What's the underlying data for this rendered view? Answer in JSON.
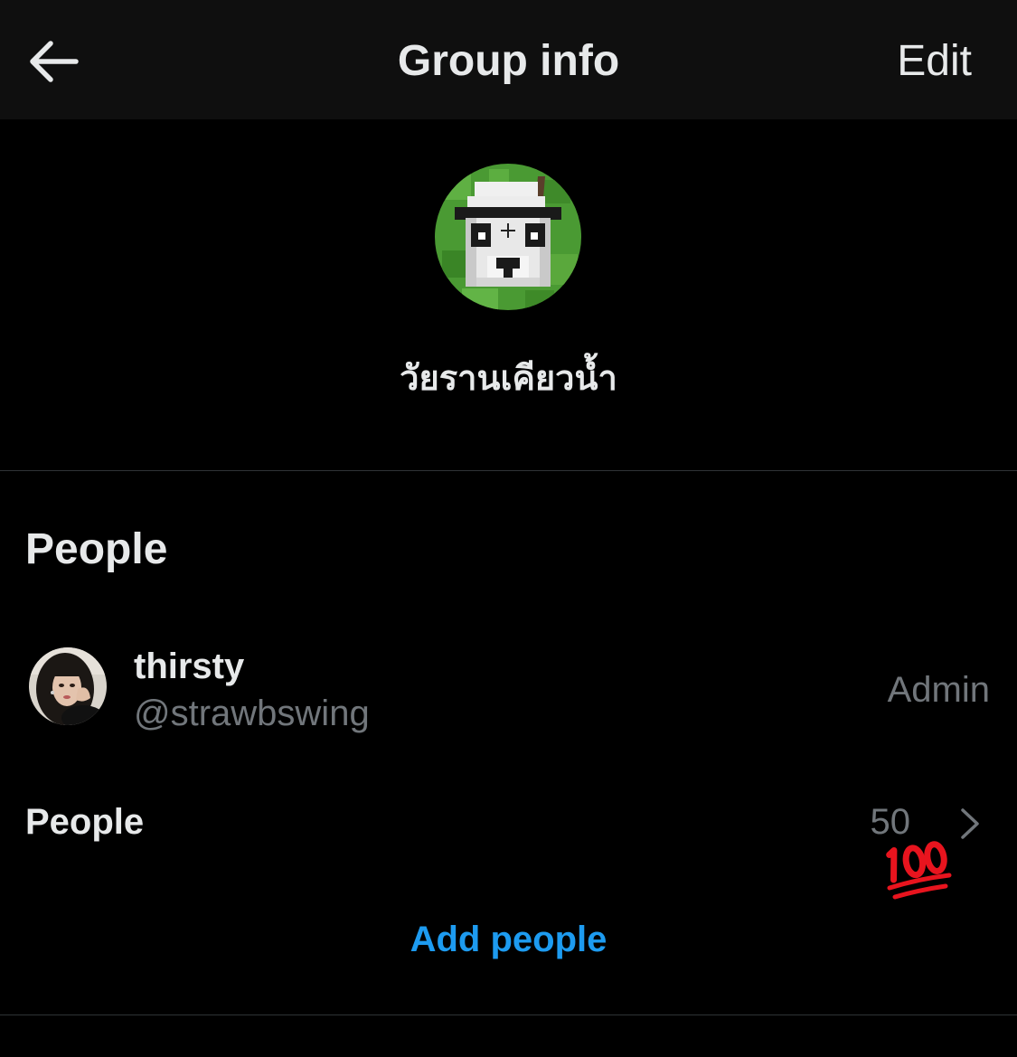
{
  "header": {
    "title": "Group info",
    "edit_label": "Edit",
    "back_icon": "arrow-left-icon"
  },
  "group": {
    "name": "วัยรานเคียวน้ำ",
    "avatar": "panda-pixel-avatar"
  },
  "people_section": {
    "heading": "People",
    "members": [
      {
        "display_name": "thirsty",
        "handle": "@strawbswing",
        "role": "Admin",
        "avatar": "user-photo-avatar"
      }
    ],
    "people_row_label": "People",
    "people_count": "50",
    "overlay_emoji": "hundred-points-emoji",
    "add_people_label": "Add people"
  },
  "colors": {
    "background": "#000000",
    "header_background": "#0f0f0f",
    "primary_text": "#e7e9ea",
    "secondary_text": "#71767b",
    "accent": "#1d9bf0",
    "divider": "#2f3336"
  }
}
